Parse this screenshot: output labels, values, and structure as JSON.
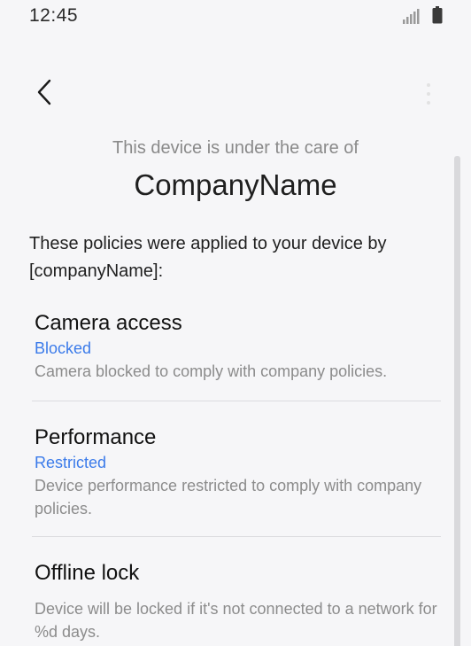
{
  "status_bar": {
    "time": "12:45",
    "icons": [
      "signal-icon",
      "battery-icon"
    ]
  },
  "toolbar": {
    "back_icon": "chevron-left-icon",
    "more_icon": "more-vertical-icon"
  },
  "header": {
    "care_text": "This device is under the care of",
    "company_name": "CompanyName"
  },
  "intro": "These policies were applied to your device by [companyName]:",
  "policies": [
    {
      "title": "Camera access",
      "status": "Blocked",
      "description": "Camera blocked to comply with company policies."
    },
    {
      "title": "Performance",
      "status": "Restricted",
      "description": "Device performance restricted to comply with company policies."
    },
    {
      "title": "Offline lock",
      "status": "",
      "description": "Device will be locked if it's not connected to a network for %d days."
    }
  ],
  "colors": {
    "background": "#f6f6f8",
    "accent": "#3b7bea",
    "secondary_text": "#8c8c8c"
  }
}
